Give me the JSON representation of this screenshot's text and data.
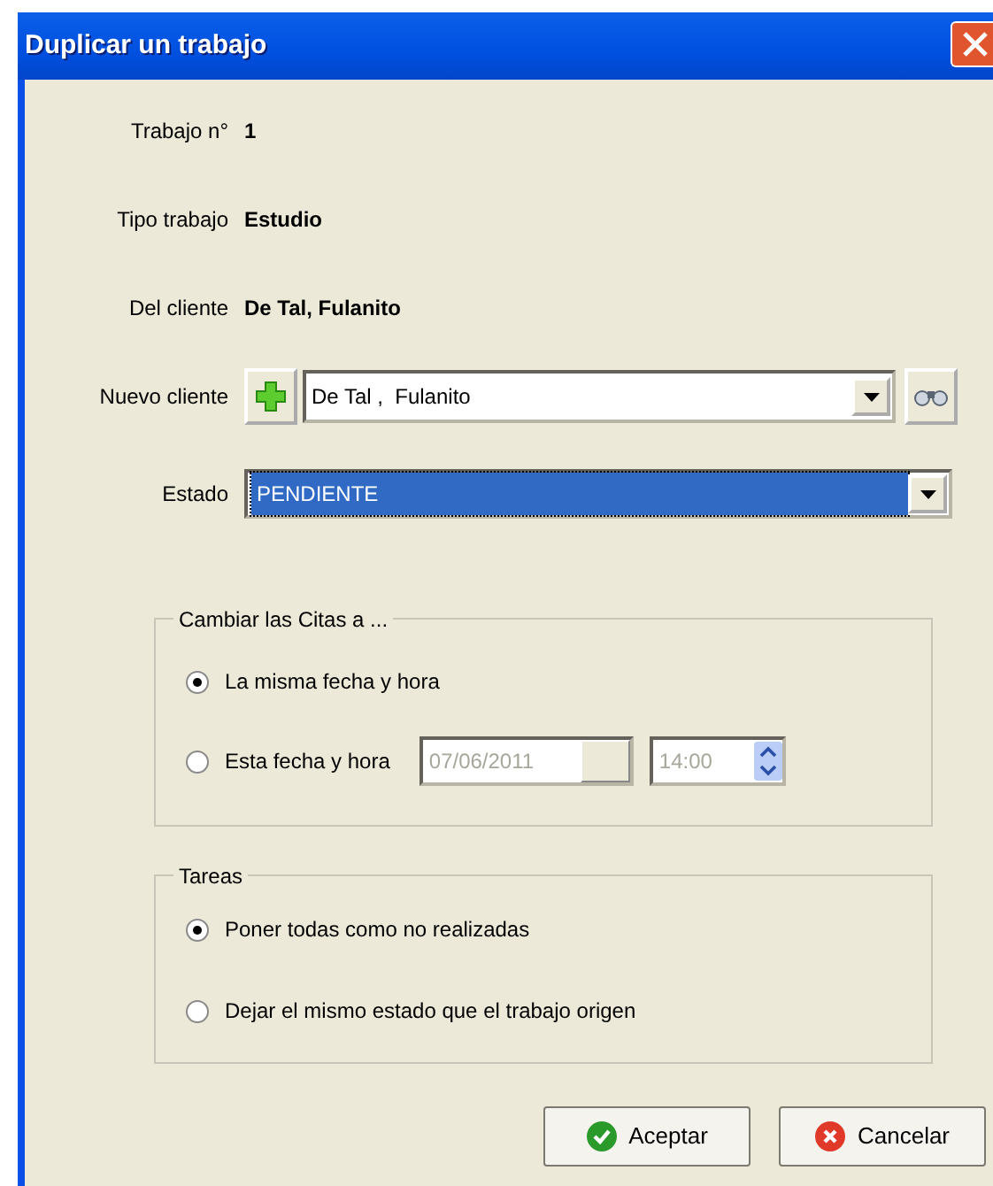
{
  "window": {
    "title": "Duplicar un trabajo"
  },
  "info_rows": [
    {
      "label": "Trabajo n°",
      "value": "1"
    },
    {
      "label": "Tipo trabajo",
      "value": "Estudio"
    },
    {
      "label": "Del cliente",
      "value": "De Tal, Fulanito"
    }
  ],
  "nuevo_cliente": {
    "label": "Nuevo cliente",
    "value": "De Tal ,  Fulanito"
  },
  "estado": {
    "label": "Estado",
    "value": "PENDIENTE",
    "highlighted": true
  },
  "citas": {
    "title": "Cambiar las Citas a ...",
    "options": [
      {
        "label": "La misma fecha y hora",
        "selected": true
      },
      {
        "label": "Esta fecha y hora",
        "selected": false,
        "date": "07/06/2011",
        "time": "14:00",
        "disabled": true
      }
    ]
  },
  "tareas": {
    "title": "Tareas",
    "options": [
      {
        "label": "Poner todas como no realizadas",
        "selected": true
      },
      {
        "label": "Dejar el mismo estado que el trabajo origen",
        "selected": false
      }
    ]
  },
  "buttons": [
    {
      "label": "Aceptar",
      "kind": "ok"
    },
    {
      "label": "Cancelar",
      "kind": "cancel"
    }
  ]
}
